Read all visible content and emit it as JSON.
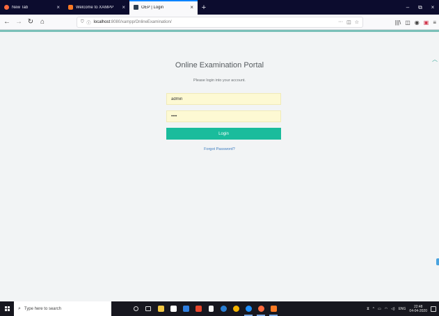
{
  "browser": {
    "tabs": [
      {
        "label": "New Tab",
        "close": "×",
        "active": false,
        "favicon_color": "#ff6a3d"
      },
      {
        "label": "Welcome to XAMPP",
        "close": "×",
        "active": false,
        "favicon_color": "#fb7a24"
      },
      {
        "label": "OEP | Login",
        "close": "×",
        "active": true,
        "favicon_color": "#2c3e50"
      }
    ],
    "new_tab": "+",
    "window_controls": {
      "minimize": "–",
      "restore": "⧉",
      "close": "×"
    },
    "nav": {
      "back": "←",
      "forward": "→",
      "reload": "↻",
      "home": "⌂"
    },
    "url": {
      "host": "localhost",
      "path": ":8080/xampp/OnlineExamination/"
    },
    "url_actions": {
      "more": "···",
      "pocket": "◫",
      "bookmark": "☆"
    },
    "toolbar_right": {
      "library": "|||\\",
      "sidebar": "◫",
      "account": "◉",
      "pocket": "▣",
      "menu": "≡"
    }
  },
  "page": {
    "title": "Online Examination Portal",
    "subtitle": "Please login into your account.",
    "username": {
      "value": "admin"
    },
    "password": {
      "value": "••••"
    },
    "login_label": "Login",
    "forgot_label": "Forgot Password?",
    "colors": {
      "accent": "#1abc9c",
      "field_bg": "#fdf9d3",
      "link": "#3b7bbf"
    }
  },
  "taskbar": {
    "search_placeholder": "Type here to search",
    "tray": {
      "lang": "ENG",
      "time": "22:48",
      "date": "04-04-2020"
    }
  }
}
